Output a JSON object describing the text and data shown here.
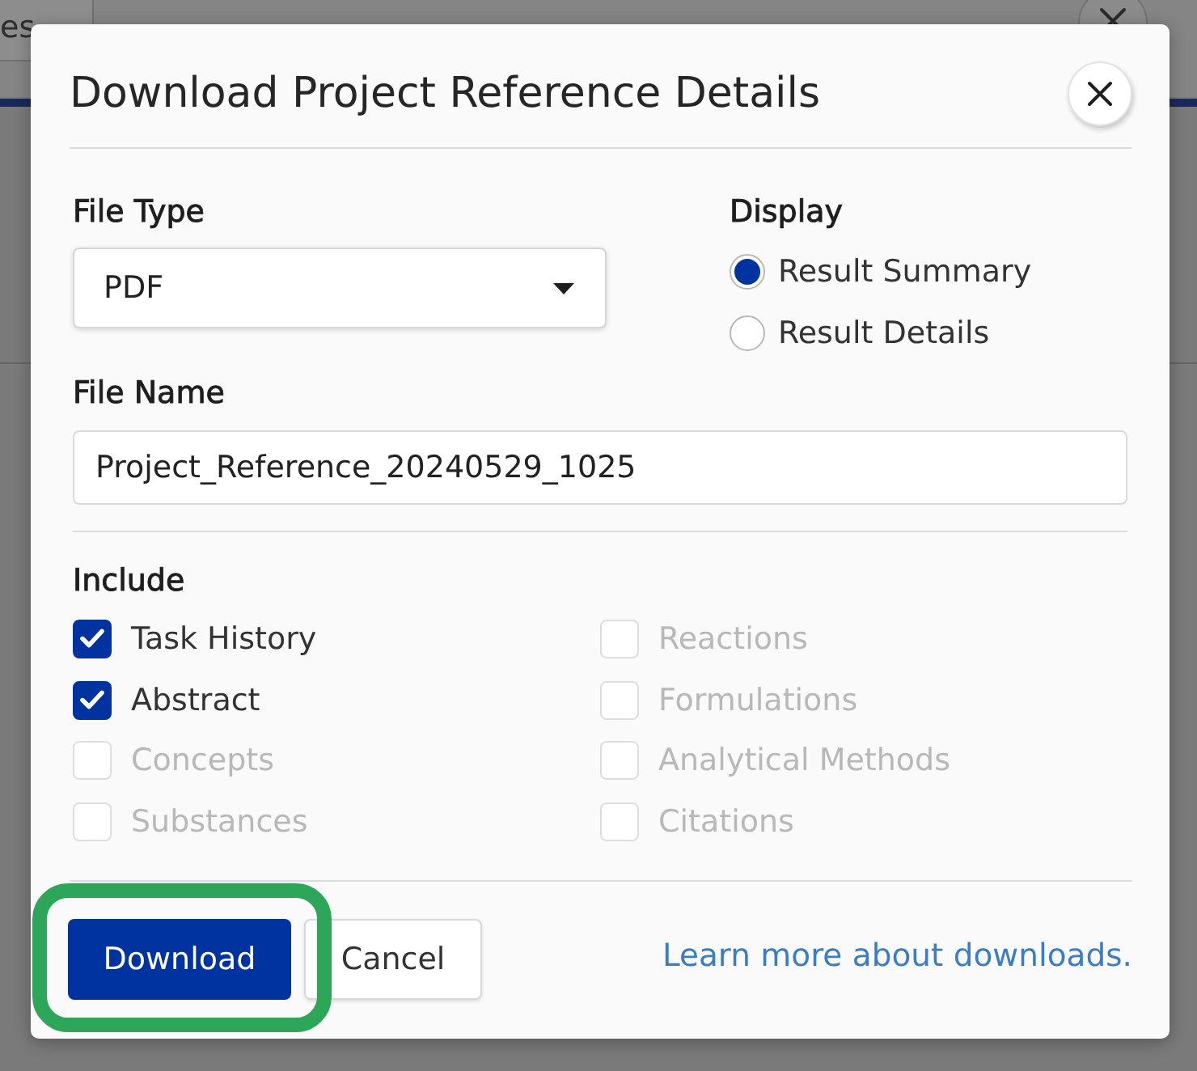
{
  "background_page": {
    "tabs": [
      {
        "label": "es"
      }
    ]
  },
  "dialog": {
    "title": "Download Project Reference Details",
    "file_type": {
      "label": "File Type",
      "value": "PDF"
    },
    "display": {
      "label": "Display",
      "options": [
        {
          "label": "Result Summary",
          "selected": true
        },
        {
          "label": "Result Details",
          "selected": false
        }
      ]
    },
    "file_name": {
      "label": "File Name",
      "value": "Project_Reference_20240529_1025"
    },
    "include": {
      "label": "Include",
      "options": [
        {
          "label": "Task History",
          "checked": true,
          "disabled": false
        },
        {
          "label": "Abstract",
          "checked": true,
          "disabled": false
        },
        {
          "label": "Concepts",
          "checked": false,
          "disabled": true
        },
        {
          "label": "Substances",
          "checked": false,
          "disabled": true
        },
        {
          "label": "Reactions",
          "checked": false,
          "disabled": true
        },
        {
          "label": "Formulations",
          "checked": false,
          "disabled": true
        },
        {
          "label": "Analytical Methods",
          "checked": false,
          "disabled": true
        },
        {
          "label": "Citations",
          "checked": false,
          "disabled": true
        }
      ]
    },
    "buttons": [
      {
        "label": "Download",
        "kind": "primary",
        "highlighted": true
      },
      {
        "label": "Cancel",
        "kind": "secondary",
        "highlighted": false
      }
    ],
    "link": "Learn more about downloads."
  }
}
